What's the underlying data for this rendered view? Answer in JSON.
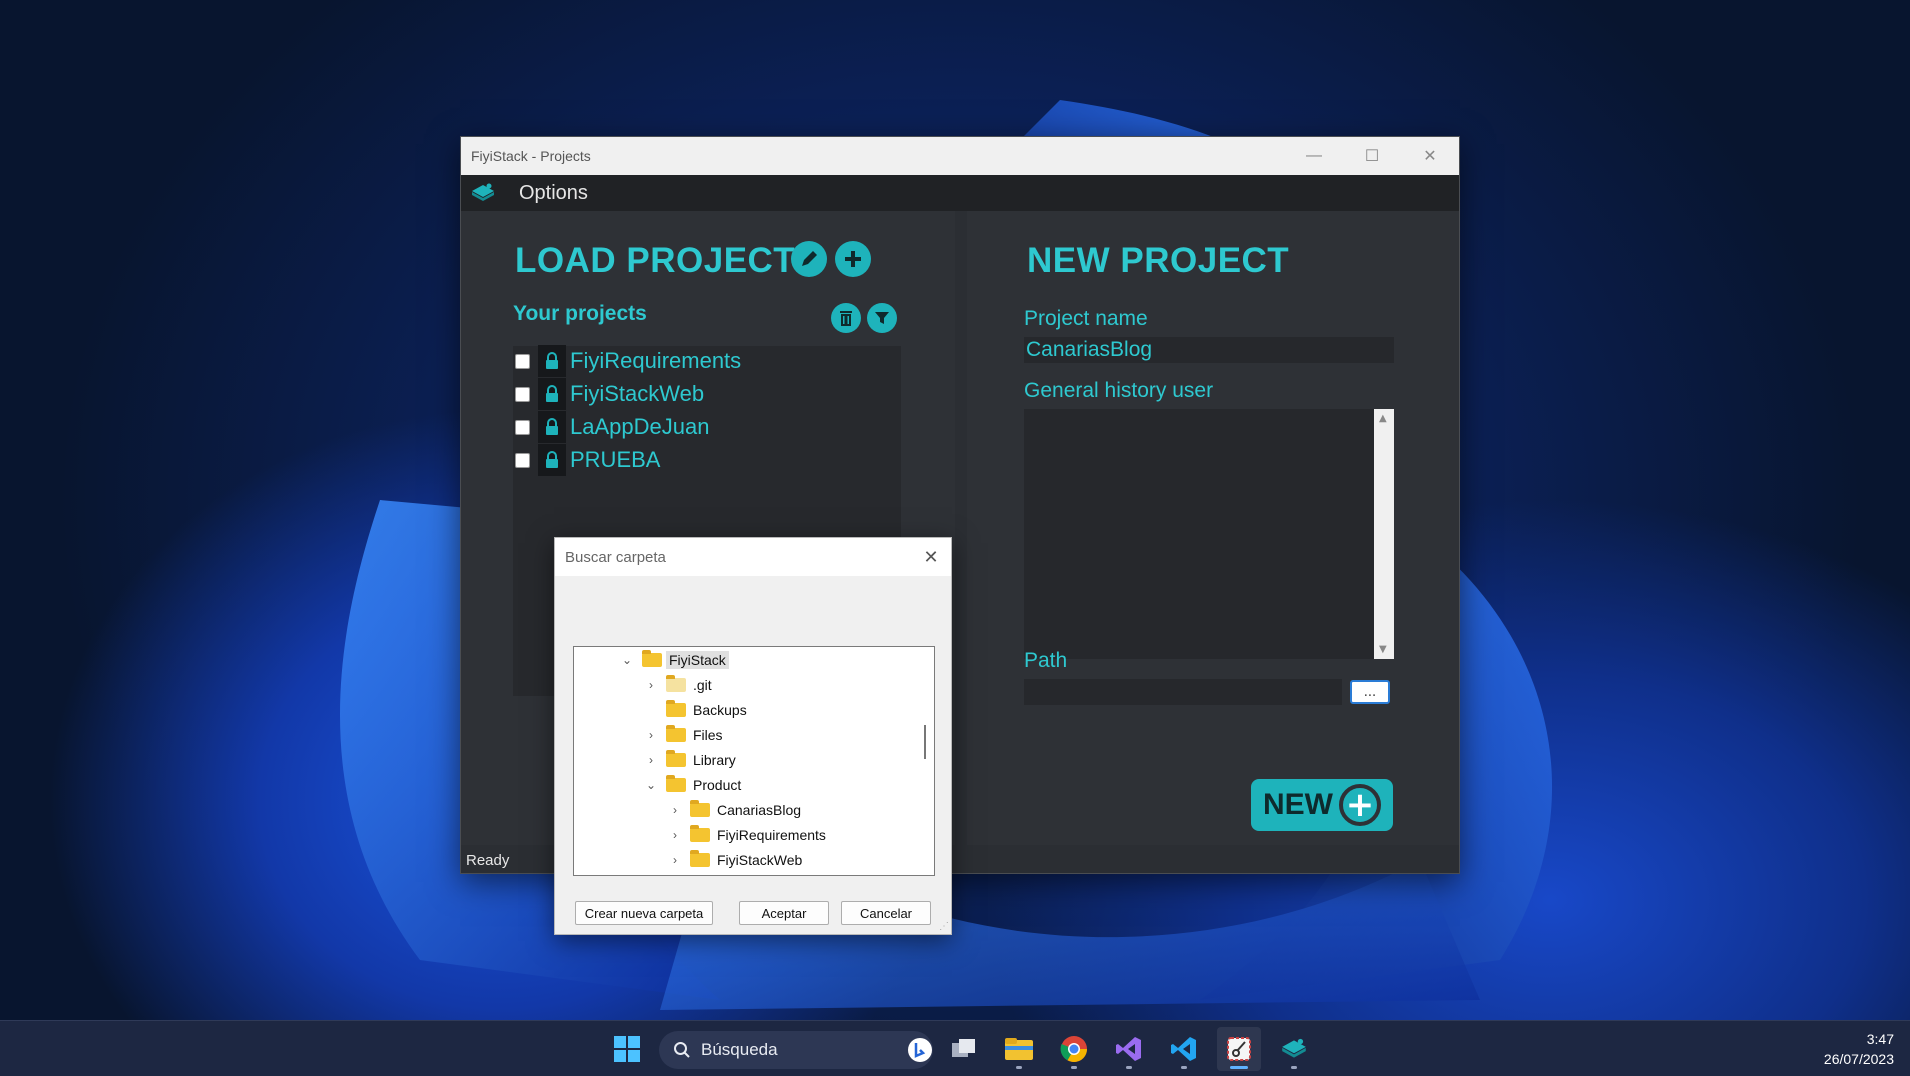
{
  "window": {
    "title": "FiyiStack - Projects",
    "minimize_glyph": "—",
    "maximize_glyph": "☐",
    "close_glyph": "✕"
  },
  "menu": {
    "options_label": "Options"
  },
  "load_project": {
    "heading": "LOAD PROJECT",
    "your_projects_label": "Your projects",
    "projects": [
      {
        "name": "FiyiRequirements",
        "checked": false
      },
      {
        "name": "FiyiStackWeb",
        "checked": false
      },
      {
        "name": "LaAppDeJuan",
        "checked": false
      },
      {
        "name": "PRUEBA",
        "checked": false
      }
    ]
  },
  "new_project": {
    "heading": "NEW PROJECT",
    "project_name_label": "Project name",
    "project_name_value": "CanariasBlog",
    "history_label": "General history user",
    "path_label": "Path",
    "path_value": "",
    "browse_label": "...",
    "new_button_label": "NEW",
    "new_button_plus": "+"
  },
  "status_bar": {
    "text": "Ready"
  },
  "dialog": {
    "title": "Buscar carpeta",
    "tree": [
      {
        "label": "FiyiStack",
        "level": 0,
        "expander": "expanded",
        "selected": true
      },
      {
        "label": ".git",
        "level": 1,
        "expander": "collapsed",
        "pale": true
      },
      {
        "label": "Backups",
        "level": 1,
        "expander": "none"
      },
      {
        "label": "Files",
        "level": 1,
        "expander": "collapsed"
      },
      {
        "label": "Library",
        "level": 1,
        "expander": "collapsed"
      },
      {
        "label": "Product",
        "level": 1,
        "expander": "expanded"
      },
      {
        "label": "CanariasBlog",
        "level": 2,
        "expander": "collapsed"
      },
      {
        "label": "FiyiRequirements",
        "level": 2,
        "expander": "collapsed"
      },
      {
        "label": "FiyiStackWeb",
        "level": 2,
        "expander": "collapsed"
      }
    ],
    "buttons": {
      "new_folder": "Crear nueva carpeta",
      "accept": "Aceptar",
      "cancel": "Cancelar"
    }
  },
  "taskbar": {
    "search_placeholder": "Búsqueda",
    "time": "3:47",
    "date": "26/07/2023",
    "apps": [
      "start-icon",
      "task-view-icon",
      "file-explorer-icon",
      "chrome-icon",
      "visual-studio-icon",
      "vscode-icon",
      "snipping-tool-icon",
      "fiyistack-icon"
    ]
  },
  "colors": {
    "accent": "#2ec9d0",
    "accent_button": "#1eb3bb",
    "window_bg": "#2e3136",
    "taskbar_bg": "#1d2742"
  }
}
